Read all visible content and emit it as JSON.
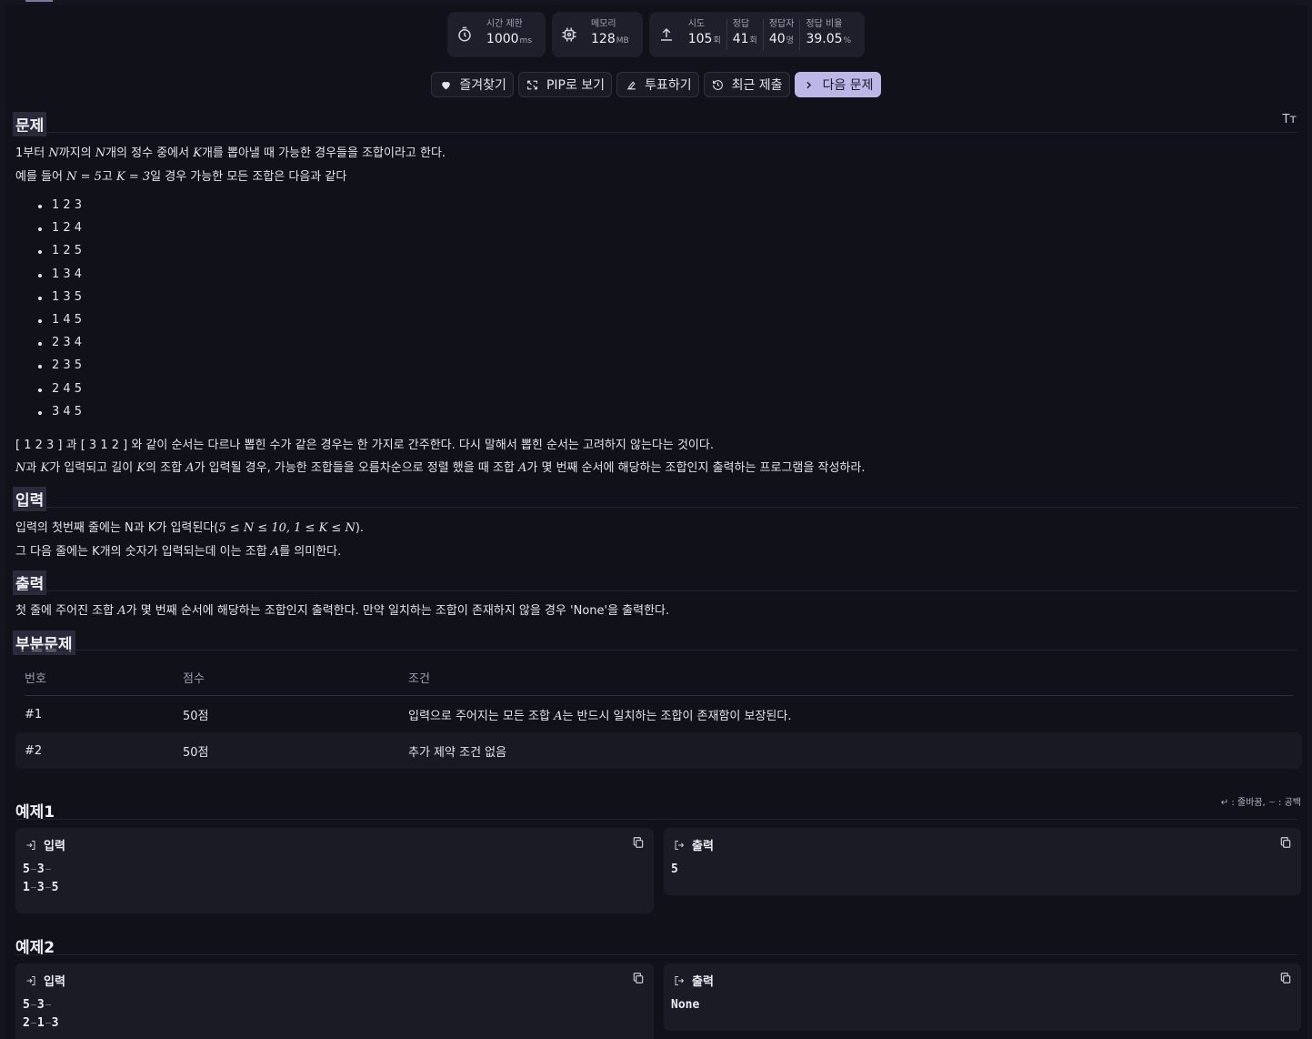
{
  "stats": [
    {
      "icon": "timer-icon",
      "items": [
        {
          "label": "시간 제한",
          "value": "1000",
          "unit": "ms"
        }
      ]
    },
    {
      "icon": "chip-icon",
      "items": [
        {
          "label": "메모리",
          "value": "128",
          "unit": "MB"
        }
      ]
    },
    {
      "icon": "upload-icon",
      "items": [
        {
          "label": "시도",
          "value": "105",
          "unit": "회"
        },
        {
          "label": "정답",
          "value": "41",
          "unit": "회"
        },
        {
          "label": "정답자",
          "value": "40",
          "unit": "명"
        },
        {
          "label": "정답 비율",
          "value": "39.05",
          "unit": "%"
        }
      ]
    }
  ],
  "actions": [
    {
      "label": "즐겨찾기",
      "icon": "heart-icon"
    },
    {
      "label": "PIP로 보기",
      "icon": "pip-icon"
    },
    {
      "label": "투표하기",
      "icon": "vote-icon"
    },
    {
      "label": "최근 제출",
      "icon": "history-icon"
    },
    {
      "label": "다음 문제",
      "icon": "chevron-right-icon"
    }
  ],
  "font_toggle": "Tт",
  "problem": {
    "heading": "문제",
    "intro": {
      "a": "1부터 ",
      "N1": "N",
      "b": "까지의 ",
      "N2": "N",
      "c": "개의 정수 중에서 ",
      "K": "K",
      "d": "개를 뽑아낼 때 가능한 경우들을 조합이라고 한다."
    },
    "example": {
      "a": "예를 들어 ",
      "eq1": "N = 5",
      "b": "고 ",
      "eq2": "K = 3",
      "c": "일 경우 가능한 모든 조합은 다음과 같다"
    },
    "combinations": [
      "1 2 3",
      "1 2 4",
      "1 2 5",
      "1 3 4",
      "1 3 5",
      "1 4 5",
      "2 3 4",
      "2 3 5",
      "2 4 5",
      "3 4 5"
    ],
    "note": "[ 1 2 3 ] 과 [ 3 1 2 ] 와 같이 순서는 다르나 뽑힌 수가 같은 경우는 한 가지로 간주한다. 다시 말해서 뽑힌 순서는 고려하지 않는다는 것이다.",
    "task": {
      "N": "N",
      "a": "과 ",
      "K": "K",
      "b": "가 입력되고 길이 ",
      "K2": "K",
      "c": "의 조합 ",
      "A": "A",
      "d": "가 입력될 경우, 가능한 조합들을 오름차순으로 정렬 했을 때 조합 ",
      "A2": "A",
      "e": "가 몇 번째 순서에 해당하는 조합인지 출력하는 프로그램을 작성하라."
    }
  },
  "input": {
    "heading": "입력",
    "line1": {
      "a": "입력의 첫번째 줄에는 N과 K가 입력된다(",
      "math": "5 ≤ N ≤ 10, 1 ≤ K ≤ N",
      "b": ")."
    },
    "line2": {
      "a": "그 다음 줄에는 K개의 숫자가 입력되는데 이는 조합 ",
      "A": "A",
      "b": "를 의미한다."
    }
  },
  "output": {
    "heading": "출력",
    "line": {
      "a": "첫 줄에 주어진 조합 ",
      "A": "A",
      "b": "가 몇 번째 순서에 해당하는 조합인지 출력한다. 만약 일치하는 조합이 존재하지 않을 경우 'None'을 출력한다."
    }
  },
  "subtasks": {
    "heading": "부분문제",
    "columns": [
      "번호",
      "점수",
      "조건"
    ],
    "rows": [
      {
        "no": "#1",
        "score": "50점",
        "cond_a": "입력으로 주어지는 모든 조합 ",
        "cond_A": "A",
        "cond_b": "는 반드시 일치하는 조합이 존재함이 보장된다."
      },
      {
        "no": "#2",
        "score": "50점",
        "cond_a": "추가 제약 조건 없음",
        "cond_A": "",
        "cond_b": ""
      }
    ]
  },
  "legend": {
    "newline_symbol": "↵",
    "newline_label": ": 줄바꿈,",
    "space_label": ": 공백"
  },
  "examples": [
    {
      "heading": "예제1",
      "input_label": "입력",
      "output_label": "출력",
      "input_lines": [
        [
          "5",
          "3"
        ],
        [
          "1",
          "3",
          "5"
        ]
      ],
      "output": "5"
    },
    {
      "heading": "예제2",
      "input_label": "입력",
      "output_label": "출력",
      "input_lines": [
        [
          "5",
          "3"
        ],
        [
          "2",
          "1",
          "3"
        ]
      ],
      "output": "None"
    }
  ],
  "colors": {
    "background": "#11111a",
    "panel": "#1b1b25",
    "accent": "#bcb7e6"
  }
}
